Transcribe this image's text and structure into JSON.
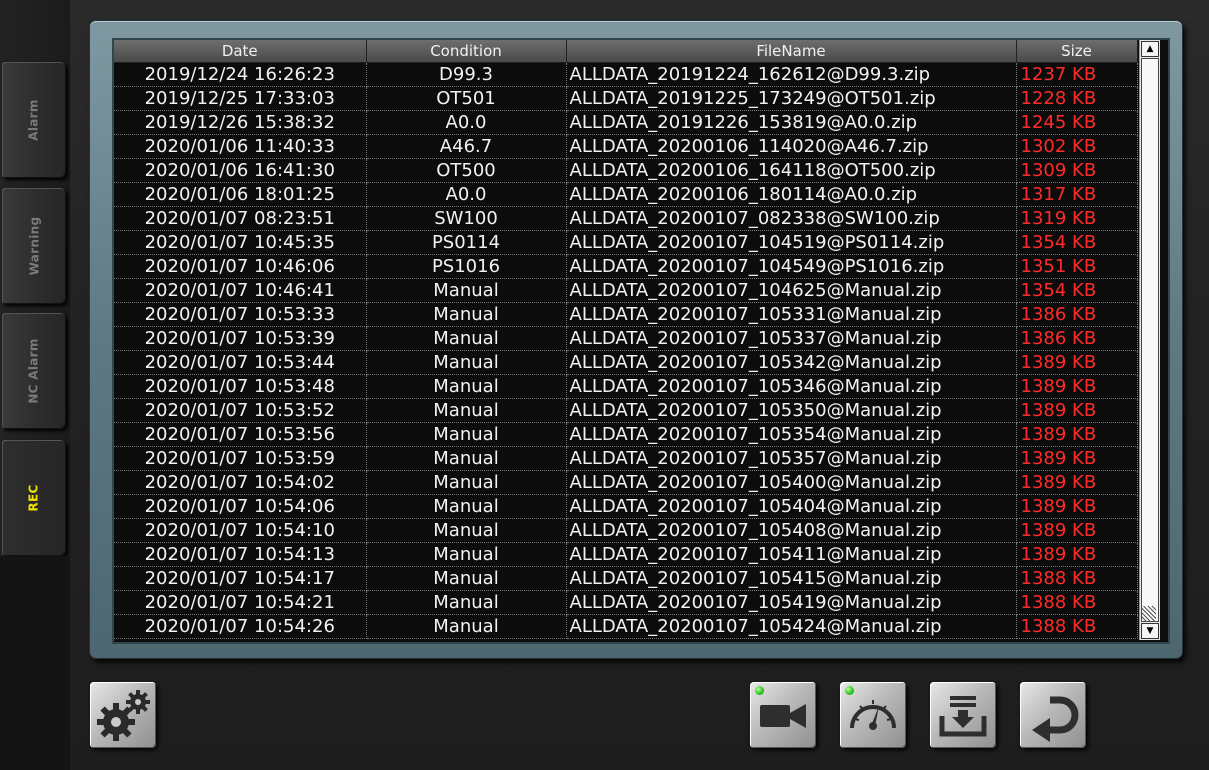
{
  "sidebar": {
    "tabs": [
      {
        "label": "Alarm",
        "active": false
      },
      {
        "label": "Warning",
        "active": false
      },
      {
        "label": "NC Alarm",
        "active": false
      },
      {
        "label": "REC",
        "active": true
      }
    ]
  },
  "table": {
    "columns": [
      "Date",
      "Condition",
      "FileName",
      "Size"
    ],
    "rows": [
      {
        "date": "2019/12/24 16:26:23",
        "condition": "D99.3",
        "filename": "ALLDATA_20191224_162612@D99.3.zip",
        "size": "1237 KB"
      },
      {
        "date": "2019/12/25 17:33:03",
        "condition": "OT501",
        "filename": "ALLDATA_20191225_173249@OT501.zip",
        "size": "1228 KB"
      },
      {
        "date": "2019/12/26 15:38:32",
        "condition": "A0.0",
        "filename": "ALLDATA_20191226_153819@A0.0.zip",
        "size": "1245 KB"
      },
      {
        "date": "2020/01/06 11:40:33",
        "condition": "A46.7",
        "filename": "ALLDATA_20200106_114020@A46.7.zip",
        "size": "1302 KB"
      },
      {
        "date": "2020/01/06 16:41:30",
        "condition": "OT500",
        "filename": "ALLDATA_20200106_164118@OT500.zip",
        "size": "1309 KB"
      },
      {
        "date": "2020/01/06 18:01:25",
        "condition": "A0.0",
        "filename": "ALLDATA_20200106_180114@A0.0.zip",
        "size": "1317 KB"
      },
      {
        "date": "2020/01/07 08:23:51",
        "condition": "SW100",
        "filename": "ALLDATA_20200107_082338@SW100.zip",
        "size": "1319 KB"
      },
      {
        "date": "2020/01/07 10:45:35",
        "condition": "PS0114",
        "filename": "ALLDATA_20200107_104519@PS0114.zip",
        "size": "1354 KB"
      },
      {
        "date": "2020/01/07 10:46:06",
        "condition": "PS1016",
        "filename": "ALLDATA_20200107_104549@PS1016.zip",
        "size": "1351 KB"
      },
      {
        "date": "2020/01/07 10:46:41",
        "condition": "Manual",
        "filename": "ALLDATA_20200107_104625@Manual.zip",
        "size": "1354 KB"
      },
      {
        "date": "2020/01/07 10:53:33",
        "condition": "Manual",
        "filename": "ALLDATA_20200107_105331@Manual.zip",
        "size": "1386 KB"
      },
      {
        "date": "2020/01/07 10:53:39",
        "condition": "Manual",
        "filename": "ALLDATA_20200107_105337@Manual.zip",
        "size": "1386 KB"
      },
      {
        "date": "2020/01/07 10:53:44",
        "condition": "Manual",
        "filename": "ALLDATA_20200107_105342@Manual.zip",
        "size": "1389 KB"
      },
      {
        "date": "2020/01/07 10:53:48",
        "condition": "Manual",
        "filename": "ALLDATA_20200107_105346@Manual.zip",
        "size": "1389 KB"
      },
      {
        "date": "2020/01/07 10:53:52",
        "condition": "Manual",
        "filename": "ALLDATA_20200107_105350@Manual.zip",
        "size": "1389 KB"
      },
      {
        "date": "2020/01/07 10:53:56",
        "condition": "Manual",
        "filename": "ALLDATA_20200107_105354@Manual.zip",
        "size": "1389 KB"
      },
      {
        "date": "2020/01/07 10:53:59",
        "condition": "Manual",
        "filename": "ALLDATA_20200107_105357@Manual.zip",
        "size": "1389 KB"
      },
      {
        "date": "2020/01/07 10:54:02",
        "condition": "Manual",
        "filename": "ALLDATA_20200107_105400@Manual.zip",
        "size": "1389 KB"
      },
      {
        "date": "2020/01/07 10:54:06",
        "condition": "Manual",
        "filename": "ALLDATA_20200107_105404@Manual.zip",
        "size": "1389 KB"
      },
      {
        "date": "2020/01/07 10:54:10",
        "condition": "Manual",
        "filename": "ALLDATA_20200107_105408@Manual.zip",
        "size": "1389 KB"
      },
      {
        "date": "2020/01/07 10:54:13",
        "condition": "Manual",
        "filename": "ALLDATA_20200107_105411@Manual.zip",
        "size": "1389 KB"
      },
      {
        "date": "2020/01/07 10:54:17",
        "condition": "Manual",
        "filename": "ALLDATA_20200107_105415@Manual.zip",
        "size": "1388 KB"
      },
      {
        "date": "2020/01/07 10:54:21",
        "condition": "Manual",
        "filename": "ALLDATA_20200107_105419@Manual.zip",
        "size": "1388 KB"
      },
      {
        "date": "2020/01/07 10:54:26",
        "condition": "Manual",
        "filename": "ALLDATA_20200107_105424@Manual.zip",
        "size": "1388 KB"
      }
    ]
  },
  "scrollbar": {
    "up_glyph": "▲",
    "down_glyph": "▼"
  },
  "toolbar": {
    "buttons": [
      {
        "name": "settings-button",
        "icon": "gears-icon",
        "led": false
      },
      {
        "name": "record-camera-button",
        "icon": "video-camera-icon",
        "led": true
      },
      {
        "name": "gauge-button",
        "icon": "gauge-icon",
        "led": true
      },
      {
        "name": "download-button",
        "icon": "download-tray-icon",
        "led": false
      },
      {
        "name": "return-button",
        "icon": "return-arrow-icon",
        "led": false
      }
    ]
  },
  "colors": {
    "size_text": "#ff2a2a",
    "active_tab": "#f2e200",
    "led_on": "#27c31d"
  }
}
